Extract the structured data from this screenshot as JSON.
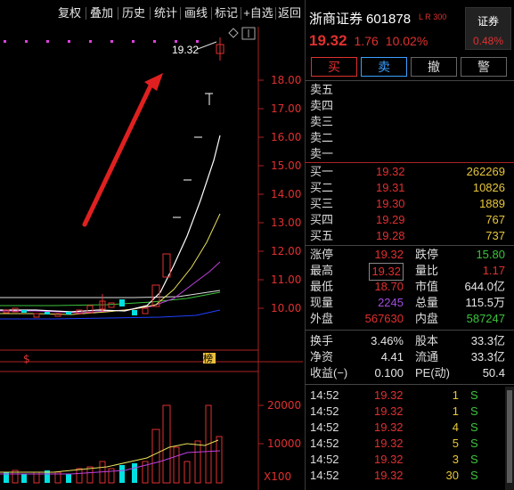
{
  "toolbar": {
    "items": [
      "复权",
      "叠加",
      "历史",
      "统计",
      "画线",
      "标记",
      "+自选",
      "返回"
    ]
  },
  "chart": {
    "max_price_label": "19.32",
    "price_axis": [
      "18.00",
      "17.00",
      "16.00",
      "15.00",
      "14.00",
      "13.00",
      "12.00",
      "11.00",
      "10.00"
    ],
    "volume_axis": [
      "20000",
      "10000"
    ],
    "volume_unit": "X100",
    "marker_left": "$",
    "marker_right": "榜"
  },
  "colors": {
    "up": "#e03030",
    "down": "#3cc43c",
    "down_candle": "#00e0e0",
    "ma5": "#ffffff",
    "ma10": "#e8e05a",
    "ma20": "#c040e0",
    "ma60": "#3cc43c",
    "ma_long": "#2040ff",
    "volume_text": "#e8c73a"
  },
  "stock": {
    "name": "浙商证券",
    "code": "601878",
    "flags": "L R",
    "flags_num": "300",
    "price": "19.32",
    "change": "1.76",
    "change_pct": "10.02%",
    "sector_name": "证券",
    "sector_pct": "0.48%"
  },
  "trade_buttons": [
    "买",
    "卖",
    "撤",
    "警"
  ],
  "sell_book": [
    {
      "label": "卖五",
      "price": "",
      "volume": ""
    },
    {
      "label": "卖四",
      "price": "",
      "volume": ""
    },
    {
      "label": "卖三",
      "price": "",
      "volume": ""
    },
    {
      "label": "卖二",
      "price": "",
      "volume": ""
    },
    {
      "label": "卖一",
      "price": "",
      "volume": ""
    }
  ],
  "buy_book": [
    {
      "label": "买一",
      "price": "19.32",
      "volume": "262269"
    },
    {
      "label": "买二",
      "price": "19.31",
      "volume": "10826"
    },
    {
      "label": "买三",
      "price": "19.30",
      "volume": "1889"
    },
    {
      "label": "买四",
      "price": "19.29",
      "volume": "767"
    },
    {
      "label": "买五",
      "price": "19.28",
      "volume": "737"
    }
  ],
  "stats": [
    {
      "k1": "涨停",
      "v1": "19.32",
      "c1": "red",
      "k2": "跌停",
      "v2": "15.80",
      "c2": "green"
    },
    {
      "k1": "最高",
      "v1": "19.32",
      "c1": "red",
      "k2": "量比",
      "v2": "1.17",
      "c2": "red"
    },
    {
      "k1": "最低",
      "v1": "18.70",
      "c1": "red",
      "k2": "市值",
      "v2": "644.0亿",
      "c2": "white"
    },
    {
      "k1": "现量",
      "v1": "2245",
      "c1": "purple",
      "k2": "总量",
      "v2": "115.5万",
      "c2": "white"
    },
    {
      "k1": "外盘",
      "v1": "567630",
      "c1": "red",
      "k2": "内盘",
      "v2": "587247",
      "c2": "green"
    }
  ],
  "stats2": [
    {
      "k1": "换手",
      "v1": "3.46%",
      "c1": "white",
      "k2": "股本",
      "v2": "33.3亿",
      "c2": "white"
    },
    {
      "k1": "净资",
      "v1": "4.41",
      "c1": "white",
      "k2": "流通",
      "v2": "33.3亿",
      "c2": "white"
    },
    {
      "k1": "收益(−)",
      "v1": "0.100",
      "c1": "white",
      "k2": "PE(动)",
      "v2": "50.4",
      "c2": "white"
    }
  ],
  "ticks": [
    {
      "time": "14:52",
      "price": "19.32",
      "vol": "1",
      "dir": "S"
    },
    {
      "time": "14:52",
      "price": "19.32",
      "vol": "1",
      "dir": "S"
    },
    {
      "time": "14:52",
      "price": "19.32",
      "vol": "4",
      "dir": "S"
    },
    {
      "time": "14:52",
      "price": "19.32",
      "vol": "5",
      "dir": "S"
    },
    {
      "time": "14:52",
      "price": "19.32",
      "vol": "3",
      "dir": "S"
    },
    {
      "time": "14:52",
      "price": "19.32",
      "vol": "30",
      "dir": "S"
    }
  ]
}
